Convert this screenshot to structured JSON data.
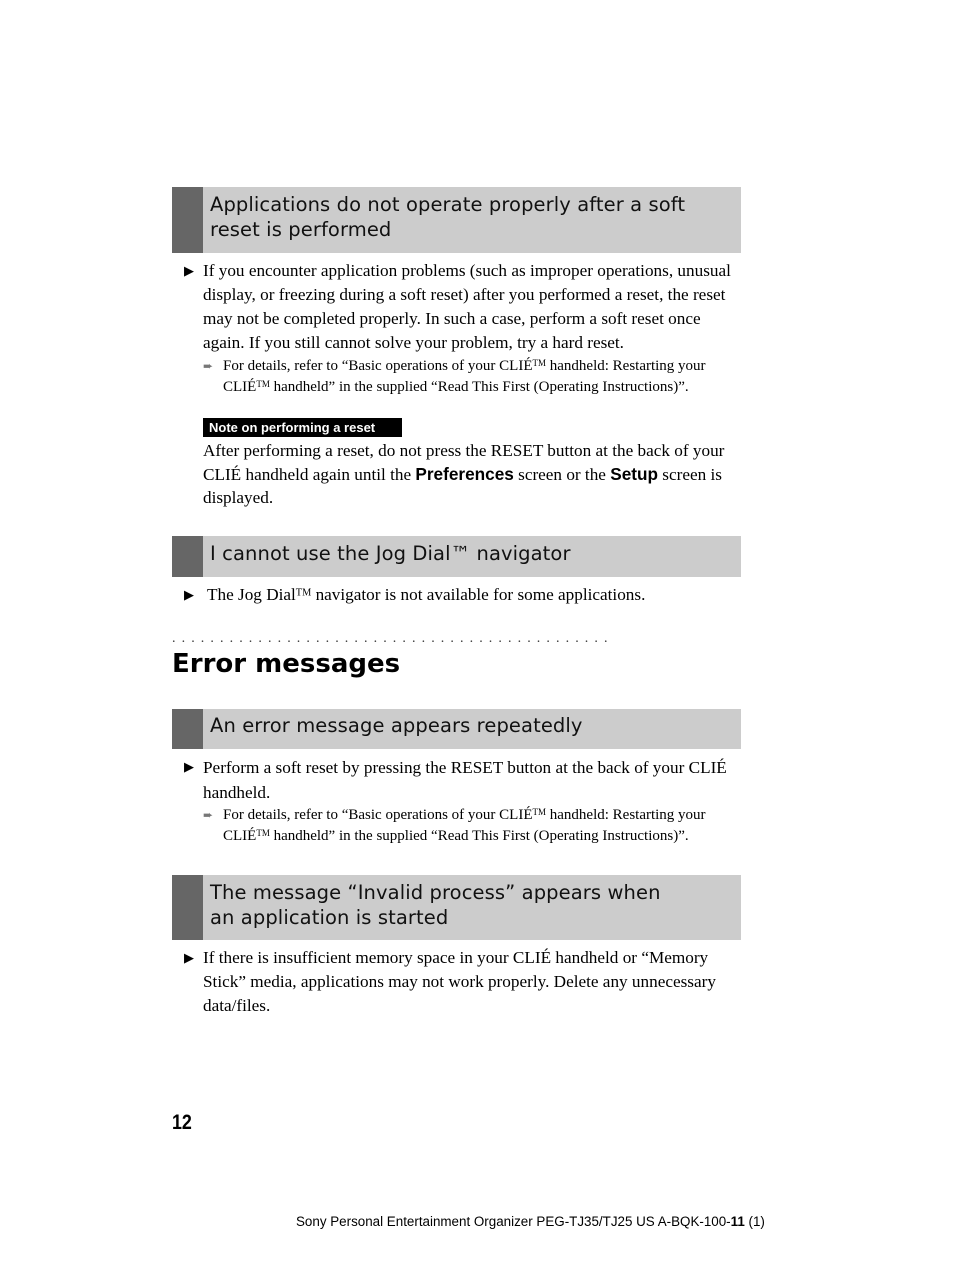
{
  "sections": [
    {
      "heading": "Applications do not operate properly after a soft reset is performed",
      "bullet": "If you encounter application problems (such as improper operations, unusual display, or freezing during a soft reset) after you performed a reset, the reset may not be completed properly. In such a case, perform a soft reset once again. If you still cannot solve your problem, try a hard reset.",
      "reference_line1": "For details, refer to “Basic operations of your CLIÉ™ handheld: Restarting your",
      "reference_line2": "CLIÉ™ handheld” in the supplied “Read This First (Operating Instructions)”.",
      "note": {
        "label": "Note on performing a reset",
        "text_before": "After performing a reset, do not press the RESET button at the back of your CLIÉ handheld again until the ",
        "bold1": "Preferences",
        "text_middle": " screen or the ",
        "bold2": "Setup",
        "text_after": " screen is displayed."
      }
    },
    {
      "heading": "I cannot use the Jog Dial™ navigator",
      "bullet": "The Jog Dial™ navigator is not available for some applications."
    }
  ],
  "error_section": {
    "dots": "..............................................",
    "title": "Error messages",
    "subsections": [
      {
        "heading": "An error message appears repeatedly",
        "bullet": "Perform a soft reset by pressing the RESET button at the back of your CLIÉ handheld.",
        "reference_line1": "For details, refer to “Basic operations of your CLIÉ™ handheld: Restarting your",
        "reference_line2": "CLIÉ™ handheld” in the supplied “Read This First (Operating Instructions)”."
      },
      {
        "heading": "The message “Invalid process” appears when an application is started",
        "bullet": "If there is insufficient memory space in your CLIÉ handheld or “Memory Stick” media, applications may not work properly. Delete any unnecessary data/files."
      }
    ]
  },
  "page_number": "12",
  "footer": {
    "text": "Sony Personal Entertainment Organizer PEG-TJ35/TJ25 US  A-BQK-100-",
    "bold": "11",
    "suffix": " (1)"
  },
  "icons": {
    "bullet": "▶",
    "reference_arrow": "➨"
  }
}
